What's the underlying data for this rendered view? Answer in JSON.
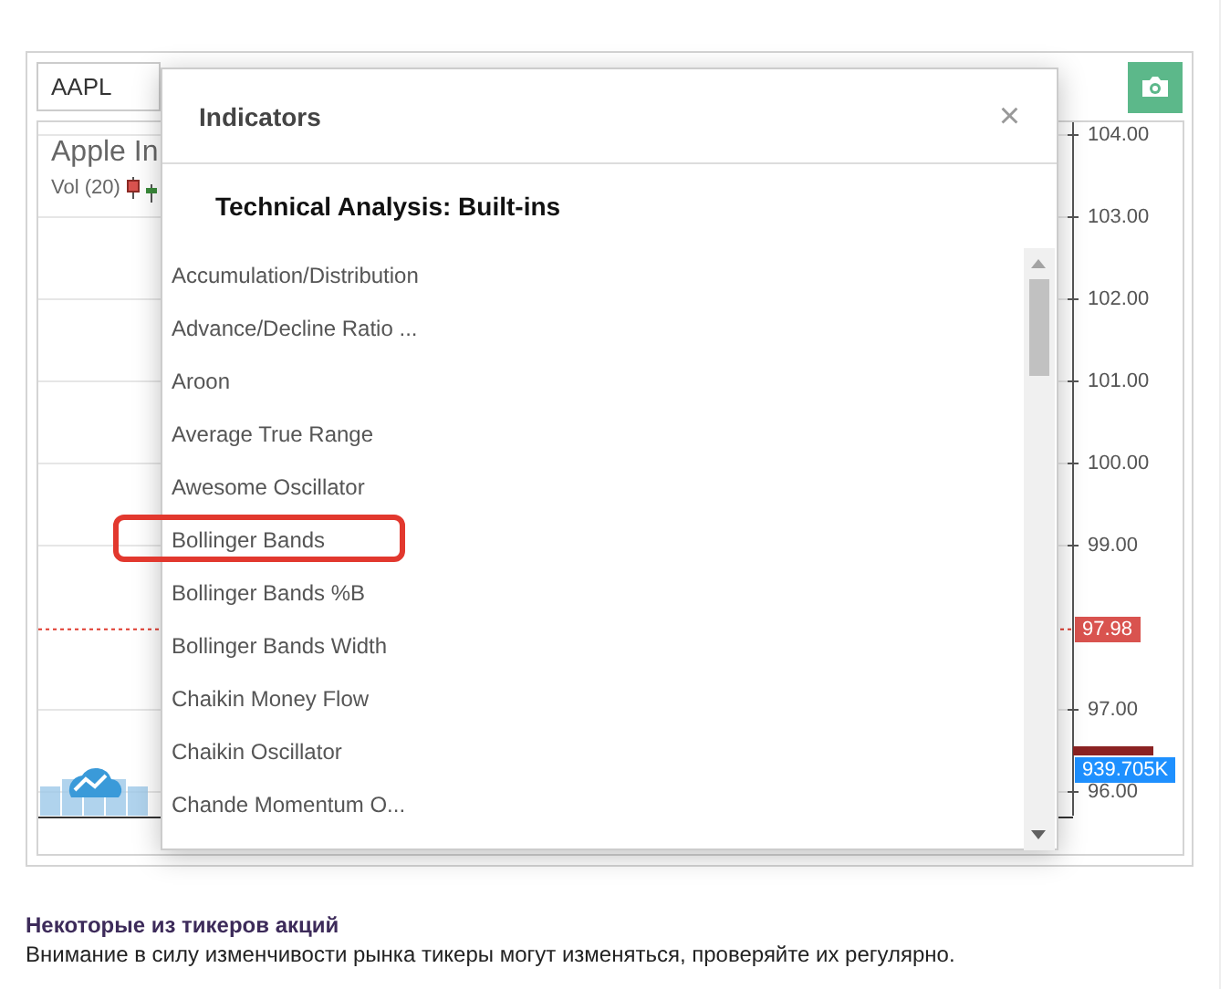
{
  "symbol_field": {
    "value": "AAPL"
  },
  "chart": {
    "title": "Apple In",
    "volume_label": "Vol (20)",
    "axis_labels": [
      "104.00",
      "103.00",
      "102.00",
      "101.00",
      "100.00",
      "99.00",
      "97.00",
      "96.00"
    ],
    "last_price": "97.98",
    "last_volume": "939.705K"
  },
  "dialog": {
    "title": "Indicators",
    "close": "×",
    "section": "Technical Analysis: Built-ins",
    "items": [
      {
        "label": "Accumulation/Distribution",
        "highlighted": false
      },
      {
        "label": "Advance/Decline Ratio ...",
        "highlighted": false
      },
      {
        "label": "Aroon",
        "highlighted": false
      },
      {
        "label": "Average True Range",
        "highlighted": false
      },
      {
        "label": "Awesome Oscillator",
        "highlighted": false
      },
      {
        "label": "Bollinger Bands",
        "highlighted": true
      },
      {
        "label": "Bollinger Bands %B",
        "highlighted": false
      },
      {
        "label": "Bollinger Bands Width",
        "highlighted": false
      },
      {
        "label": "Chaikin Money Flow",
        "highlighted": false
      },
      {
        "label": "Chaikin Oscillator",
        "highlighted": false
      },
      {
        "label": "Chande Momentum O...",
        "highlighted": false
      }
    ]
  },
  "note": {
    "heading": "Некоторые из тикеров акций",
    "text": "Внимание в силу изменчивости рынка тикеры могут изменяться, проверяйте их регулярно."
  }
}
